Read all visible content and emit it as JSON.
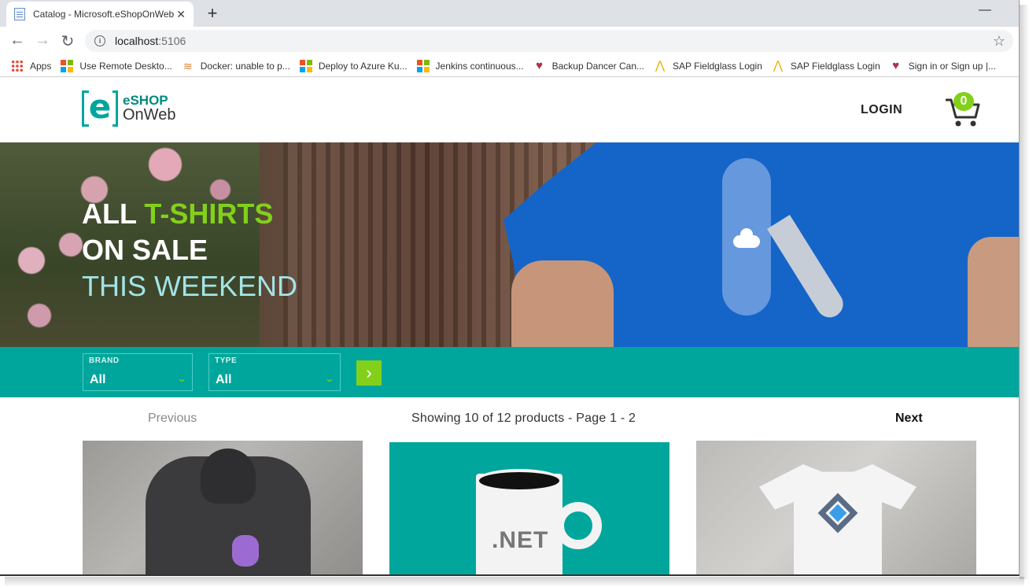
{
  "browser": {
    "tab_title": "Catalog - Microsoft.eShopOnWeb",
    "address_host": "localhost",
    "address_port": ":5106",
    "bookmarks": [
      {
        "label": "Apps",
        "icon": "apps-grid-icon"
      },
      {
        "label": "Use Remote Deskto...",
        "icon": "microsoft-icon"
      },
      {
        "label": "Docker: unable to p...",
        "icon": "docker-icon"
      },
      {
        "label": "Deploy to Azure Ku...",
        "icon": "microsoft-icon"
      },
      {
        "label": "Jenkins continuous...",
        "icon": "microsoft-icon"
      },
      {
        "label": "Backup Dancer Can...",
        "icon": "heart-icon"
      },
      {
        "label": "SAP Fieldglass Login",
        "icon": "sap-icon"
      },
      {
        "label": "SAP Fieldglass Login",
        "icon": "sap-icon"
      },
      {
        "label": "Sign in or Sign up |...",
        "icon": "heart-icon"
      }
    ]
  },
  "site": {
    "logo_line1": "eSHOP",
    "logo_line2": "OnWeb",
    "logo_mark": "e",
    "login_label": "LOGIN",
    "cart_count": "0"
  },
  "hero": {
    "line1_a": "ALL ",
    "line1_b": "T-SHIRTS",
    "line2": "ON SALE",
    "line3": "THIS WEEKEND"
  },
  "filters": {
    "brand_label": "BRAND",
    "brand_value": "All",
    "type_label": "TYPE",
    "type_value": "All"
  },
  "pager": {
    "previous": "Previous",
    "info": "Showing 10 of 12 products - Page 1 - 2",
    "next": "Next"
  },
  "products": {
    "mug_text": ".NET"
  },
  "colors": {
    "brand_teal": "#00a69c",
    "accent_green": "#83d01b"
  }
}
